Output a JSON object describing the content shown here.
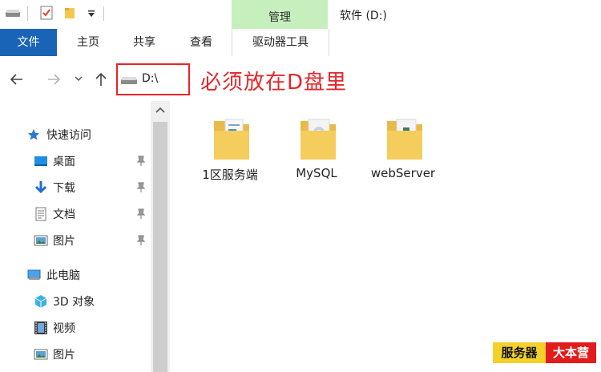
{
  "titlebar": {
    "window_title": "软件 (D:)",
    "contextual_tab_header": "管理"
  },
  "ribbon": {
    "tabs": [
      "文件",
      "主页",
      "共享",
      "查看",
      "驱动器工具"
    ]
  },
  "address": {
    "path": "D:\\"
  },
  "annotation": {
    "text": "必须放在D盘里",
    "color": "#e8242a"
  },
  "sidebar": {
    "quick_access": "快速访问",
    "pinned": [
      "桌面",
      "下载",
      "文档",
      "图片"
    ],
    "this_pc": "此电脑",
    "pc_items": [
      "3D 对象",
      "视频",
      "图片"
    ]
  },
  "files": [
    {
      "name": "1区服务端",
      "icon": "folder-icon"
    },
    {
      "name": "MySQL",
      "icon": "folder-icon"
    },
    {
      "name": "webServer",
      "icon": "folder-icon"
    }
  ],
  "watermark": {
    "left": "服务器",
    "right": "大本营"
  },
  "colors": {
    "accent_blue": "#1a64b8",
    "manage_green": "#c6efbd",
    "folder_yellow": "#f5cd5c"
  }
}
